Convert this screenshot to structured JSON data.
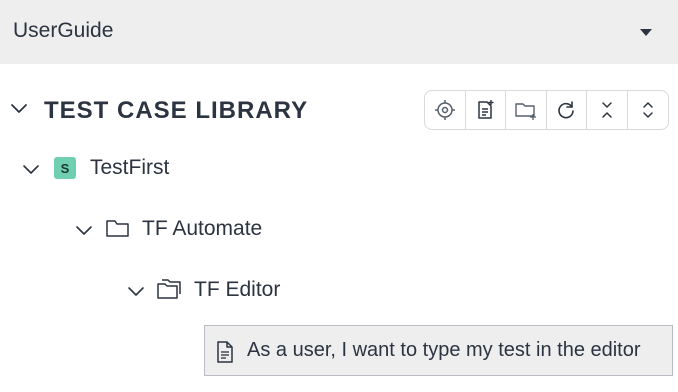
{
  "project": {
    "name": "UserGuide"
  },
  "library": {
    "title": "TEST CASE LIBRARY",
    "toolbar": [
      "locate-icon",
      "new-test-case-icon",
      "new-folder-icon",
      "refresh-icon",
      "collapse-all-icon",
      "expand-all-icon"
    ]
  },
  "tree": {
    "suite": {
      "label": "TestFirst",
      "badge": "S"
    },
    "folder1": {
      "label": "TF Automate"
    },
    "folder2": {
      "label": "TF Editor"
    },
    "test_case": {
      "label": "As a user, I want to type my test in the editor"
    }
  },
  "colors": {
    "project_bar_bg": "#eeeeef",
    "suite_badge": "#6fcfb0",
    "text": "#2b3440",
    "selected_row_bg": "#eeeeef"
  }
}
